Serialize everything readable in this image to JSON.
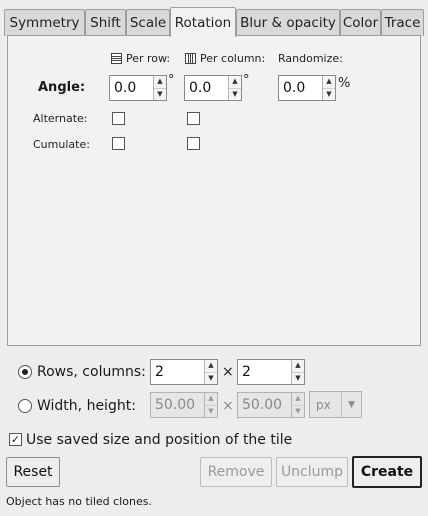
{
  "tabs": [
    {
      "label": "Symmetry",
      "active": false
    },
    {
      "label": "Shift",
      "active": false
    },
    {
      "label": "Scale",
      "active": false
    },
    {
      "label": "Rotation",
      "active": true
    },
    {
      "label": "Blur & opacity",
      "active": false
    },
    {
      "label": "Color",
      "active": false
    },
    {
      "label": "Trace",
      "active": false
    }
  ],
  "rotation": {
    "col_per_row": "Per row:",
    "col_per_column": "Per column:",
    "col_randomize": "Randomize:",
    "angle_label": "Angle:",
    "angle_per_row": "0.0",
    "angle_per_column": "0.0",
    "angle_randomize": "0.0",
    "degree_unit": "°",
    "percent_unit": "%",
    "alternate_label": "Alternate:",
    "cumulate_label": "Cumulate:",
    "alternate_per_row": false,
    "alternate_per_column": false,
    "cumulate_per_row": false,
    "cumulate_per_column": false
  },
  "grid": {
    "rows_columns_label": "Rows, columns:",
    "rows_columns_selected": true,
    "rows": "2",
    "columns": "2",
    "times": "×",
    "width_height_label": "Width, height:",
    "width_height_selected": false,
    "width": "50.00",
    "height": "50.00",
    "unit": "px"
  },
  "use_saved_label": "Use saved size and position of the tile",
  "use_saved_checked": true,
  "buttons": {
    "reset": "Reset",
    "remove": "Remove",
    "unclump": "Unclump",
    "create": "Create"
  },
  "status": "Object has no tiled clones.",
  "icons": {
    "per_row": "rows-icon",
    "per_column": "columns-icon"
  }
}
